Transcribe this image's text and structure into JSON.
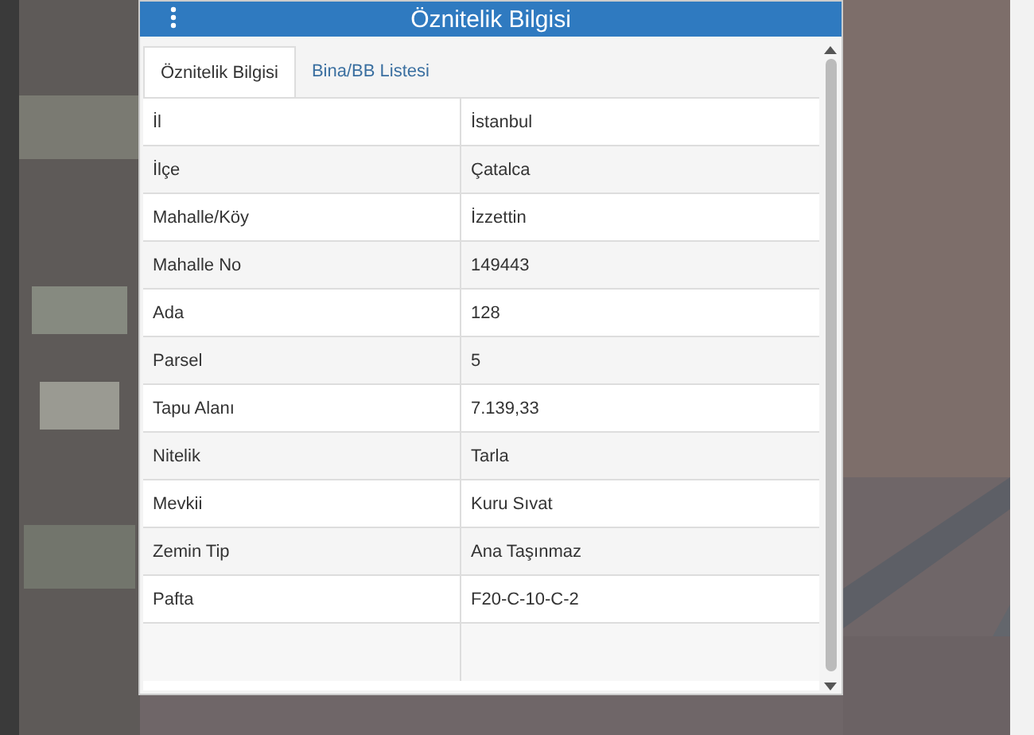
{
  "dialog": {
    "title": "Öznitelik Bilgisi"
  },
  "tabs": [
    {
      "label": "Öznitelik Bilgisi",
      "selected": true
    },
    {
      "label": "Bina/BB Listesi",
      "selected": false
    }
  ],
  "table": {
    "rows": [
      {
        "field": "İl",
        "value": "İstanbul"
      },
      {
        "field": "İlçe",
        "value": "Çatalca"
      },
      {
        "field": "Mahalle/Köy",
        "value": "İzzettin"
      },
      {
        "field": "Mahalle No",
        "value": "149443"
      },
      {
        "field": "Ada",
        "value": "128"
      },
      {
        "field": "Parsel",
        "value": "5"
      },
      {
        "field": "Tapu Alanı",
        "value": "7.139,33"
      },
      {
        "field": "Nitelik",
        "value": "Tarla"
      },
      {
        "field": "Mevkii",
        "value": "Kuru Sıvat"
      },
      {
        "field": "Zemin Tip",
        "value": "Ana Taşınmaz"
      },
      {
        "field": "Pafta",
        "value": "F20-C-10-C-2"
      }
    ]
  }
}
